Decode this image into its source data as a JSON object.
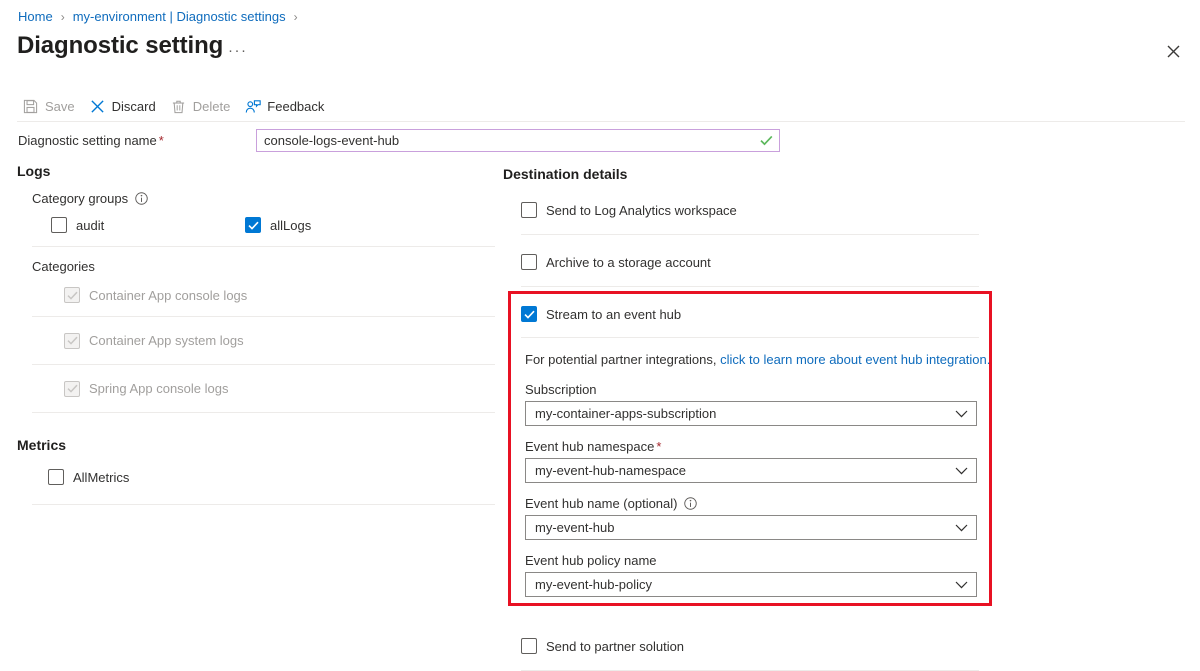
{
  "breadcrumb": {
    "items": [
      {
        "label": "Home"
      },
      {
        "label": "my-environment | Diagnostic settings"
      }
    ],
    "separator": "›"
  },
  "header": {
    "title": "Diagnostic setting",
    "ellipsis": "···",
    "close_icon": "close-icon"
  },
  "toolbar": {
    "items": [
      {
        "label": "Save",
        "icon": "save-icon",
        "disabled": true
      },
      {
        "label": "Discard",
        "icon": "discard-icon",
        "disabled": false
      },
      {
        "label": "Delete",
        "icon": "delete-icon",
        "disabled": true
      },
      {
        "label": "Feedback",
        "icon": "feedback-icon",
        "disabled": false
      }
    ]
  },
  "name_field": {
    "label": "Diagnostic setting name",
    "required_marker": "*",
    "value": "console-logs-event-hub",
    "placeholder": "Enter a name",
    "valid_icon": "checkmark-icon",
    "border_color": "#c9a0dc",
    "valid_color": "#5cb85c"
  },
  "logs": {
    "title": "Logs",
    "category_groups": {
      "label": "Category groups",
      "info_icon": "info-icon",
      "items": [
        {
          "label": "audit",
          "checked": false,
          "disabled": false
        },
        {
          "label": "allLogs",
          "checked": true,
          "disabled": false
        }
      ]
    },
    "categories": {
      "label": "Categories",
      "items": [
        {
          "label": "Container App console logs",
          "checked": true,
          "disabled": true
        },
        {
          "label": "Container App system logs",
          "checked": true,
          "disabled": true
        },
        {
          "label": "Spring App console logs",
          "checked": true,
          "disabled": true
        }
      ]
    }
  },
  "metrics": {
    "title": "Metrics",
    "items": [
      {
        "label": "AllMetrics",
        "checked": false,
        "disabled": false
      }
    ]
  },
  "destination": {
    "title": "Destination details",
    "log_analytics": {
      "label": "Send to Log Analytics workspace",
      "checked": false
    },
    "storage": {
      "label": "Archive to a storage account",
      "checked": false
    },
    "event_hub": {
      "label": "Stream to an event hub",
      "checked": true,
      "note_prefix": "For potential partner integrations, ",
      "note_link": "click to learn more about event hub integration.",
      "fields": [
        {
          "label": "Subscription",
          "required": false,
          "info": false,
          "value": "my-container-apps-subscription"
        },
        {
          "label": "Event hub namespace",
          "required": true,
          "info": false,
          "value": "my-event-hub-namespace"
        },
        {
          "label": "Event hub name (optional)",
          "required": false,
          "info": true,
          "value": "my-event-hub"
        },
        {
          "label": "Event hub policy name",
          "required": false,
          "info": false,
          "value": "my-event-hub-policy"
        }
      ]
    },
    "partner": {
      "label": "Send to partner solution",
      "checked": false
    }
  },
  "highlight": {
    "color": "#e81123",
    "target": "stream-to-event-hub-section"
  },
  "accent_color": "#0078d4"
}
